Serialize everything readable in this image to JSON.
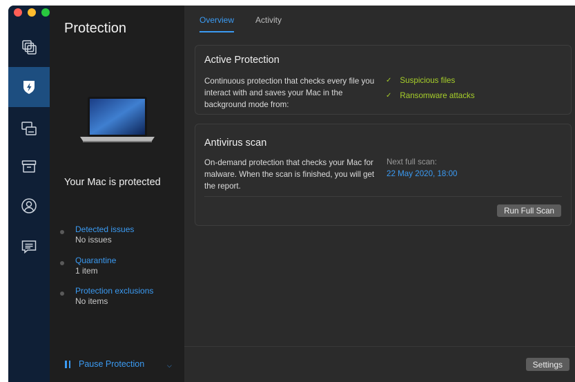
{
  "window": {
    "traffic_lights": {
      "close": "#ff5f57",
      "minimize": "#febc2e",
      "zoom": "#28c840"
    }
  },
  "rail": {
    "items": [
      {
        "icon": "copy-stack-icon"
      },
      {
        "icon": "shield-bolt-icon",
        "active": true
      },
      {
        "icon": "devices-icon"
      },
      {
        "icon": "archive-box-icon"
      },
      {
        "icon": "user-circle-icon"
      },
      {
        "icon": "chat-message-icon"
      }
    ]
  },
  "summary": {
    "title": "Protection",
    "status": "Your Mac is protected",
    "stats": [
      {
        "label": "Detected issues",
        "value": "No issues"
      },
      {
        "label": "Quarantine",
        "value": "1 item"
      },
      {
        "label": "Protection exclusions",
        "value": "No items"
      }
    ],
    "pause_label": "Pause Protection"
  },
  "tabs": [
    {
      "label": "Overview",
      "active": true
    },
    {
      "label": "Activity",
      "active": false
    }
  ],
  "active_protection": {
    "title": "Active Protection",
    "description": "Continuous protection that checks every file you interact with and saves your Mac in the background mode from:",
    "items": [
      "Suspicious files",
      "Ransomware attacks"
    ]
  },
  "antivirus_scan": {
    "title": "Antivirus scan",
    "description": "On-demand protection that checks your Mac for malware. When the scan is finished, you will get the report.",
    "next_scan_label": "Next full scan:",
    "next_scan_date": "22 May 2020, 18:00",
    "button_label": "Run Full Scan"
  },
  "footer": {
    "settings_label": "Settings"
  },
  "colors": {
    "accent": "#3b9bf3",
    "check_green": "#a7cf2a",
    "rail_bg": "#0f1f36",
    "rail_active": "#1d4e80"
  }
}
